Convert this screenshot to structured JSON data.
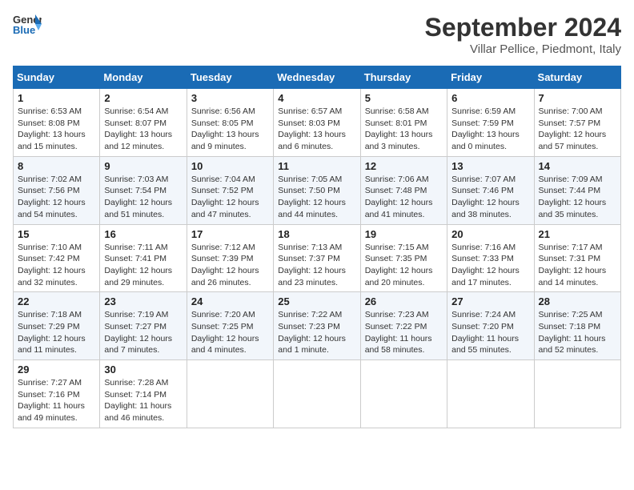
{
  "logo": {
    "line1": "General",
    "line2": "Blue"
  },
  "title": "September 2024",
  "subtitle": "Villar Pellice, Piedmont, Italy",
  "weekdays": [
    "Sunday",
    "Monday",
    "Tuesday",
    "Wednesday",
    "Thursday",
    "Friday",
    "Saturday"
  ],
  "weeks": [
    [
      {
        "day": "1",
        "info": "Sunrise: 6:53 AM\nSunset: 8:08 PM\nDaylight: 13 hours\nand 15 minutes."
      },
      {
        "day": "2",
        "info": "Sunrise: 6:54 AM\nSunset: 8:07 PM\nDaylight: 13 hours\nand 12 minutes."
      },
      {
        "day": "3",
        "info": "Sunrise: 6:56 AM\nSunset: 8:05 PM\nDaylight: 13 hours\nand 9 minutes."
      },
      {
        "day": "4",
        "info": "Sunrise: 6:57 AM\nSunset: 8:03 PM\nDaylight: 13 hours\nand 6 minutes."
      },
      {
        "day": "5",
        "info": "Sunrise: 6:58 AM\nSunset: 8:01 PM\nDaylight: 13 hours\nand 3 minutes."
      },
      {
        "day": "6",
        "info": "Sunrise: 6:59 AM\nSunset: 7:59 PM\nDaylight: 13 hours\nand 0 minutes."
      },
      {
        "day": "7",
        "info": "Sunrise: 7:00 AM\nSunset: 7:57 PM\nDaylight: 12 hours\nand 57 minutes."
      }
    ],
    [
      {
        "day": "8",
        "info": "Sunrise: 7:02 AM\nSunset: 7:56 PM\nDaylight: 12 hours\nand 54 minutes."
      },
      {
        "day": "9",
        "info": "Sunrise: 7:03 AM\nSunset: 7:54 PM\nDaylight: 12 hours\nand 51 minutes."
      },
      {
        "day": "10",
        "info": "Sunrise: 7:04 AM\nSunset: 7:52 PM\nDaylight: 12 hours\nand 47 minutes."
      },
      {
        "day": "11",
        "info": "Sunrise: 7:05 AM\nSunset: 7:50 PM\nDaylight: 12 hours\nand 44 minutes."
      },
      {
        "day": "12",
        "info": "Sunrise: 7:06 AM\nSunset: 7:48 PM\nDaylight: 12 hours\nand 41 minutes."
      },
      {
        "day": "13",
        "info": "Sunrise: 7:07 AM\nSunset: 7:46 PM\nDaylight: 12 hours\nand 38 minutes."
      },
      {
        "day": "14",
        "info": "Sunrise: 7:09 AM\nSunset: 7:44 PM\nDaylight: 12 hours\nand 35 minutes."
      }
    ],
    [
      {
        "day": "15",
        "info": "Sunrise: 7:10 AM\nSunset: 7:42 PM\nDaylight: 12 hours\nand 32 minutes."
      },
      {
        "day": "16",
        "info": "Sunrise: 7:11 AM\nSunset: 7:41 PM\nDaylight: 12 hours\nand 29 minutes."
      },
      {
        "day": "17",
        "info": "Sunrise: 7:12 AM\nSunset: 7:39 PM\nDaylight: 12 hours\nand 26 minutes."
      },
      {
        "day": "18",
        "info": "Sunrise: 7:13 AM\nSunset: 7:37 PM\nDaylight: 12 hours\nand 23 minutes."
      },
      {
        "day": "19",
        "info": "Sunrise: 7:15 AM\nSunset: 7:35 PM\nDaylight: 12 hours\nand 20 minutes."
      },
      {
        "day": "20",
        "info": "Sunrise: 7:16 AM\nSunset: 7:33 PM\nDaylight: 12 hours\nand 17 minutes."
      },
      {
        "day": "21",
        "info": "Sunrise: 7:17 AM\nSunset: 7:31 PM\nDaylight: 12 hours\nand 14 minutes."
      }
    ],
    [
      {
        "day": "22",
        "info": "Sunrise: 7:18 AM\nSunset: 7:29 PM\nDaylight: 12 hours\nand 11 minutes."
      },
      {
        "day": "23",
        "info": "Sunrise: 7:19 AM\nSunset: 7:27 PM\nDaylight: 12 hours\nand 7 minutes."
      },
      {
        "day": "24",
        "info": "Sunrise: 7:20 AM\nSunset: 7:25 PM\nDaylight: 12 hours\nand 4 minutes."
      },
      {
        "day": "25",
        "info": "Sunrise: 7:22 AM\nSunset: 7:23 PM\nDaylight: 12 hours\nand 1 minute."
      },
      {
        "day": "26",
        "info": "Sunrise: 7:23 AM\nSunset: 7:22 PM\nDaylight: 11 hours\nand 58 minutes."
      },
      {
        "day": "27",
        "info": "Sunrise: 7:24 AM\nSunset: 7:20 PM\nDaylight: 11 hours\nand 55 minutes."
      },
      {
        "day": "28",
        "info": "Sunrise: 7:25 AM\nSunset: 7:18 PM\nDaylight: 11 hours\nand 52 minutes."
      }
    ],
    [
      {
        "day": "29",
        "info": "Sunrise: 7:27 AM\nSunset: 7:16 PM\nDaylight: 11 hours\nand 49 minutes."
      },
      {
        "day": "30",
        "info": "Sunrise: 7:28 AM\nSunset: 7:14 PM\nDaylight: 11 hours\nand 46 minutes."
      },
      {
        "day": "",
        "info": ""
      },
      {
        "day": "",
        "info": ""
      },
      {
        "day": "",
        "info": ""
      },
      {
        "day": "",
        "info": ""
      },
      {
        "day": "",
        "info": ""
      }
    ]
  ]
}
